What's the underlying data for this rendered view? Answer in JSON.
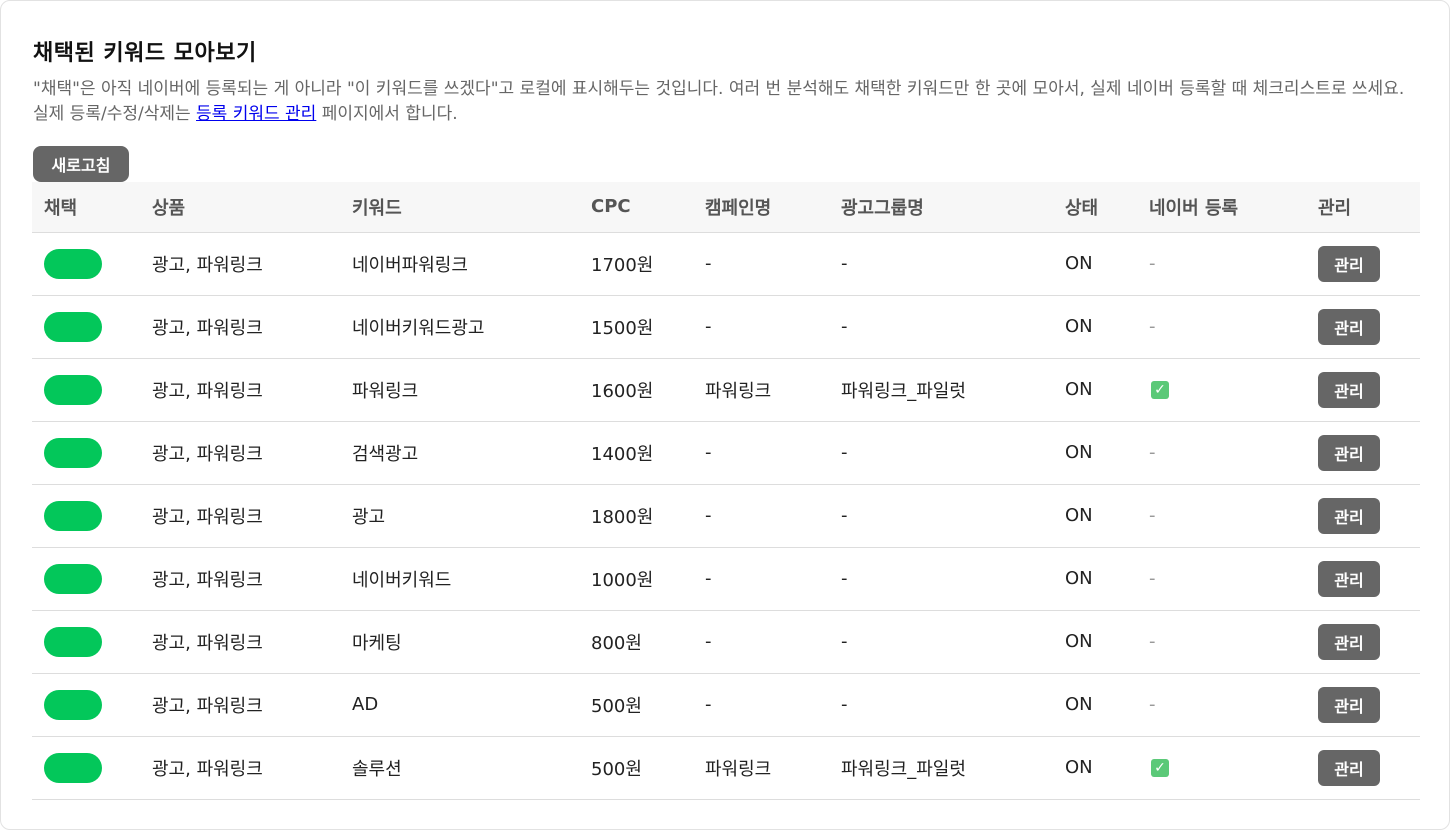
{
  "page": {
    "title": "채택된 키워드 모아보기",
    "desc_before": "\"채택\"은 아직 네이버에 등록되는 게 아니라 \"이 키워드를 쓰겠다\"고 로컬에 표시해두는 것입니다. 여러 번 분석해도 채택한 키워드만 한 곳에 모아서, 실제 네이버 등록할 때 체크리스트로 쓰세요. 실제 등록/수정/삭제는 ",
    "desc_link": "등록 키워드 관리",
    "desc_after": " 페이지에서 합니다.",
    "refresh_label": "새로고침"
  },
  "colors": {
    "toggle_on": "#03c75a",
    "button_bg": "#666666",
    "link": "#0000ee",
    "check": "#5bc978"
  },
  "table": {
    "headers": [
      "채택",
      "상품",
      "키워드",
      "CPC",
      "캠페인명",
      "광고그룹명",
      "상태",
      "네이버 등록",
      "관리"
    ],
    "rows": [
      {
        "adopted": true,
        "product": "광고, 파워링크",
        "keyword": "네이버파워링크",
        "cpc": "1700원",
        "campaign": "-",
        "adgroup": "-",
        "status": "ON",
        "registered": false,
        "registered_text": "-",
        "manage": "관리"
      },
      {
        "adopted": true,
        "product": "광고, 파워링크",
        "keyword": "네이버키워드광고",
        "cpc": "1500원",
        "campaign": "-",
        "adgroup": "-",
        "status": "ON",
        "registered": false,
        "registered_text": "-",
        "manage": "관리"
      },
      {
        "adopted": true,
        "product": "광고, 파워링크",
        "keyword": "파워링크",
        "cpc": "1600원",
        "campaign": "파워링크",
        "adgroup": "파워링크_파일럿",
        "status": "ON",
        "registered": true,
        "registered_text": "✓",
        "manage": "관리"
      },
      {
        "adopted": true,
        "product": "광고, 파워링크",
        "keyword": "검색광고",
        "cpc": "1400원",
        "campaign": "-",
        "adgroup": "-",
        "status": "ON",
        "registered": false,
        "registered_text": "-",
        "manage": "관리"
      },
      {
        "adopted": true,
        "product": "광고, 파워링크",
        "keyword": "광고",
        "cpc": "1800원",
        "campaign": "-",
        "adgroup": "-",
        "status": "ON",
        "registered": false,
        "registered_text": "-",
        "manage": "관리"
      },
      {
        "adopted": true,
        "product": "광고, 파워링크",
        "keyword": "네이버키워드",
        "cpc": "1000원",
        "campaign": "-",
        "adgroup": "-",
        "status": "ON",
        "registered": false,
        "registered_text": "-",
        "manage": "관리"
      },
      {
        "adopted": true,
        "product": "광고, 파워링크",
        "keyword": "마케팅",
        "cpc": "800원",
        "campaign": "-",
        "adgroup": "-",
        "status": "ON",
        "registered": false,
        "registered_text": "-",
        "manage": "관리"
      },
      {
        "adopted": true,
        "product": "광고, 파워링크",
        "keyword": "AD",
        "cpc": "500원",
        "campaign": "-",
        "adgroup": "-",
        "status": "ON",
        "registered": false,
        "registered_text": "-",
        "manage": "관리"
      },
      {
        "adopted": true,
        "product": "광고, 파워링크",
        "keyword": "솔루션",
        "cpc": "500원",
        "campaign": "파워링크",
        "adgroup": "파워링크_파일럿",
        "status": "ON",
        "registered": true,
        "registered_text": "✓",
        "manage": "관리"
      }
    ]
  }
}
